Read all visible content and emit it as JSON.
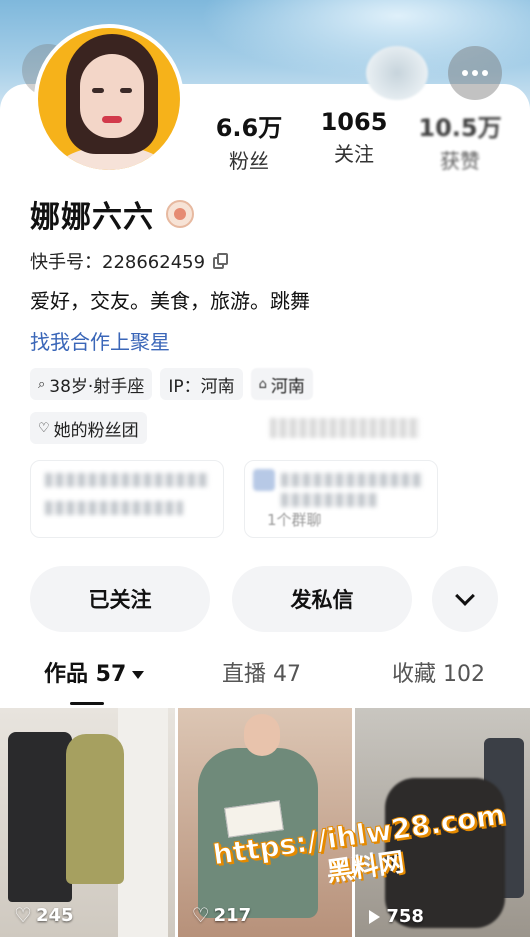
{
  "profile": {
    "name": "娜娜六六",
    "id_label": "快手号：228662459",
    "bio": "爱好，交友。美食，旅游。跳舞",
    "cooperate_link": "找我合作上聚星"
  },
  "stats": {
    "fans_value": "6.6万",
    "fans_label": "粉丝",
    "follow_value": "1065",
    "follow_label": "关注",
    "likes_value": "10.5万",
    "likes_label": "获赞"
  },
  "tags": {
    "age": "38岁·射手座",
    "ip": "IP：河南",
    "school": "河南",
    "fanclub": "她的粉丝团"
  },
  "groups": {
    "second_sub": "1个群聊"
  },
  "actions": {
    "followed": "已关注",
    "message": "发私信"
  },
  "tabs": {
    "works": "作品 57",
    "live": "直播 47",
    "favorites": "收藏 102"
  },
  "videos": [
    {
      "count": "245",
      "icon": "heart-icon"
    },
    {
      "count": "217",
      "icon": "heart-icon"
    },
    {
      "count": "758",
      "icon": "play-icon"
    }
  ],
  "watermark": {
    "url": "https://ihlw28.com",
    "name": "黑料网"
  }
}
